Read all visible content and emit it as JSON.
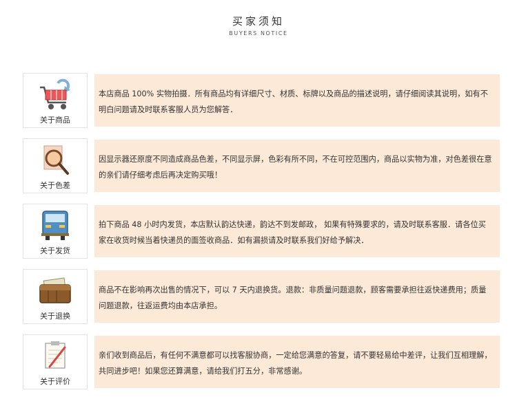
{
  "header": {
    "title_cn": "买家须知",
    "title_en": "BUYERS NOTICE"
  },
  "notices": [
    {
      "icon": "shopping-cart-icon",
      "label": "关于商品",
      "text": "本店商品 100% 实物拍摄．所有商品均有详细尺寸、材质、标牌以及商品的描述说明，请仔细阅读其说明，如有不明白问题请及时联系客服人员为您解答．"
    },
    {
      "icon": "magnifier-icon",
      "label": "关于色差",
      "text": "因显示器还原度不同造成商品色差，不同显示屏，色彩有所不同，不在可控范围内，商品以实物为准，对色差很在意的亲们请仔细考虑后再决定购买哦！"
    },
    {
      "icon": "delivery-truck-icon",
      "label": "关于发货",
      "text": "拍下商品 48 小时内发货，本店默认韵达快递，韵达不到发邮政， 如果有特殊要求的，请及时联系客服．请各位买家在收货时候当着快递员的面签收商品．如有漏损请及时联系我们好给予解决．"
    },
    {
      "icon": "wallet-icon",
      "label": "关于退换",
      "text": "商品不在影响再次出售的情况下，可以 7 天内退换货。退款：非质量问题退款，顾客需要承担往返快递费用；质量问题退款，往返运费均由本店承担。"
    },
    {
      "icon": "clipboard-pen-icon",
      "label": "关于评价",
      "text": "亲们收到商品后，有任何不满意都可以找客服协商，一定给您满意的答复，请不要轻易给中差评，让我们互相理解，共同进步吧！如果您还算满意，请给我们打五分，非常感谢。"
    }
  ],
  "colors": {
    "panel_background": "#fce9d7",
    "border": "#e3e3e3"
  }
}
